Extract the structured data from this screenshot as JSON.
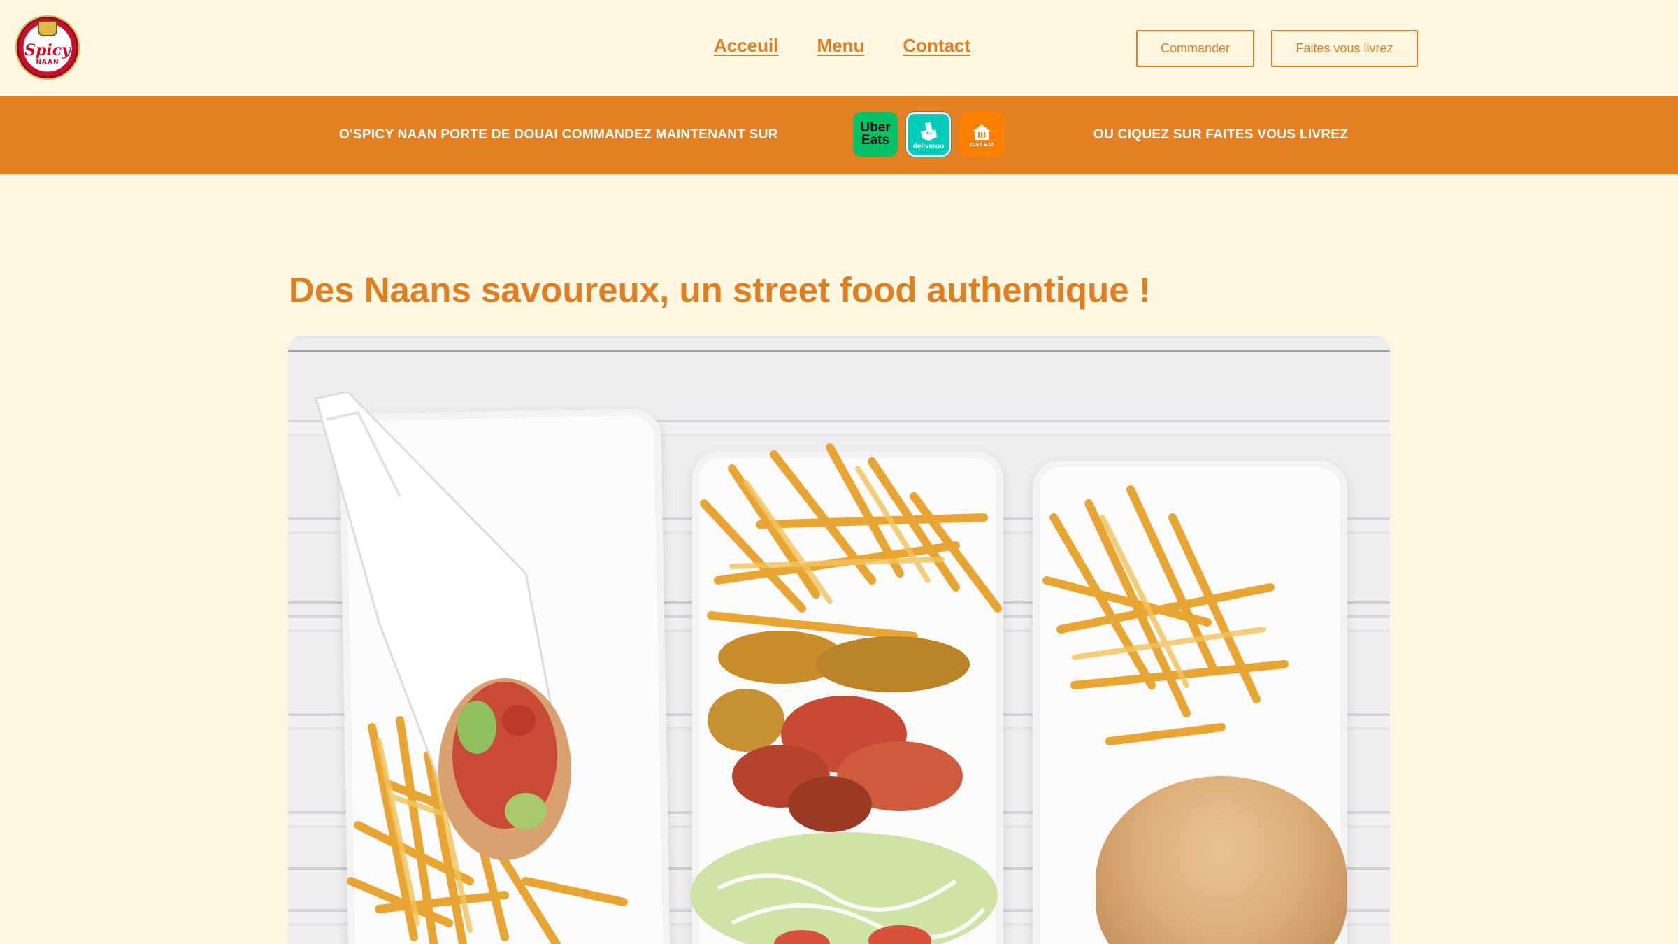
{
  "brand": {
    "logo_text": "Spicy",
    "logo_sub": "NAAN",
    "colors": {
      "accent": "#e07f22",
      "banner": "#e47f22",
      "background": "#fff7e2"
    }
  },
  "nav": {
    "items": [
      "Acceuil",
      "Menu",
      "Contact"
    ]
  },
  "actions": {
    "commander_label": "Commander",
    "livrez_label": "Faites vous livrez"
  },
  "banner": {
    "left_text": "O'SPICY NAAN PORTE DE DOUAI COMMANDEZ MAINTENANT SUR",
    "right_text": "OU CIQUEZ SUR FAITES VOUS LIVREZ",
    "delivery": [
      {
        "name": "Uber Eats",
        "line1": "Uber",
        "line2": "Eats",
        "color": "#06c167",
        "icon": "uber-eats-icon"
      },
      {
        "name": "deliveroo",
        "color": "#00ccbc",
        "icon": "deliveroo-icon"
      },
      {
        "name": "JUST EAT",
        "color": "#ff8000",
        "icon": "just-eat-icon"
      }
    ]
  },
  "main": {
    "headline": "Des Naans savoureux, un street food authentique !"
  }
}
